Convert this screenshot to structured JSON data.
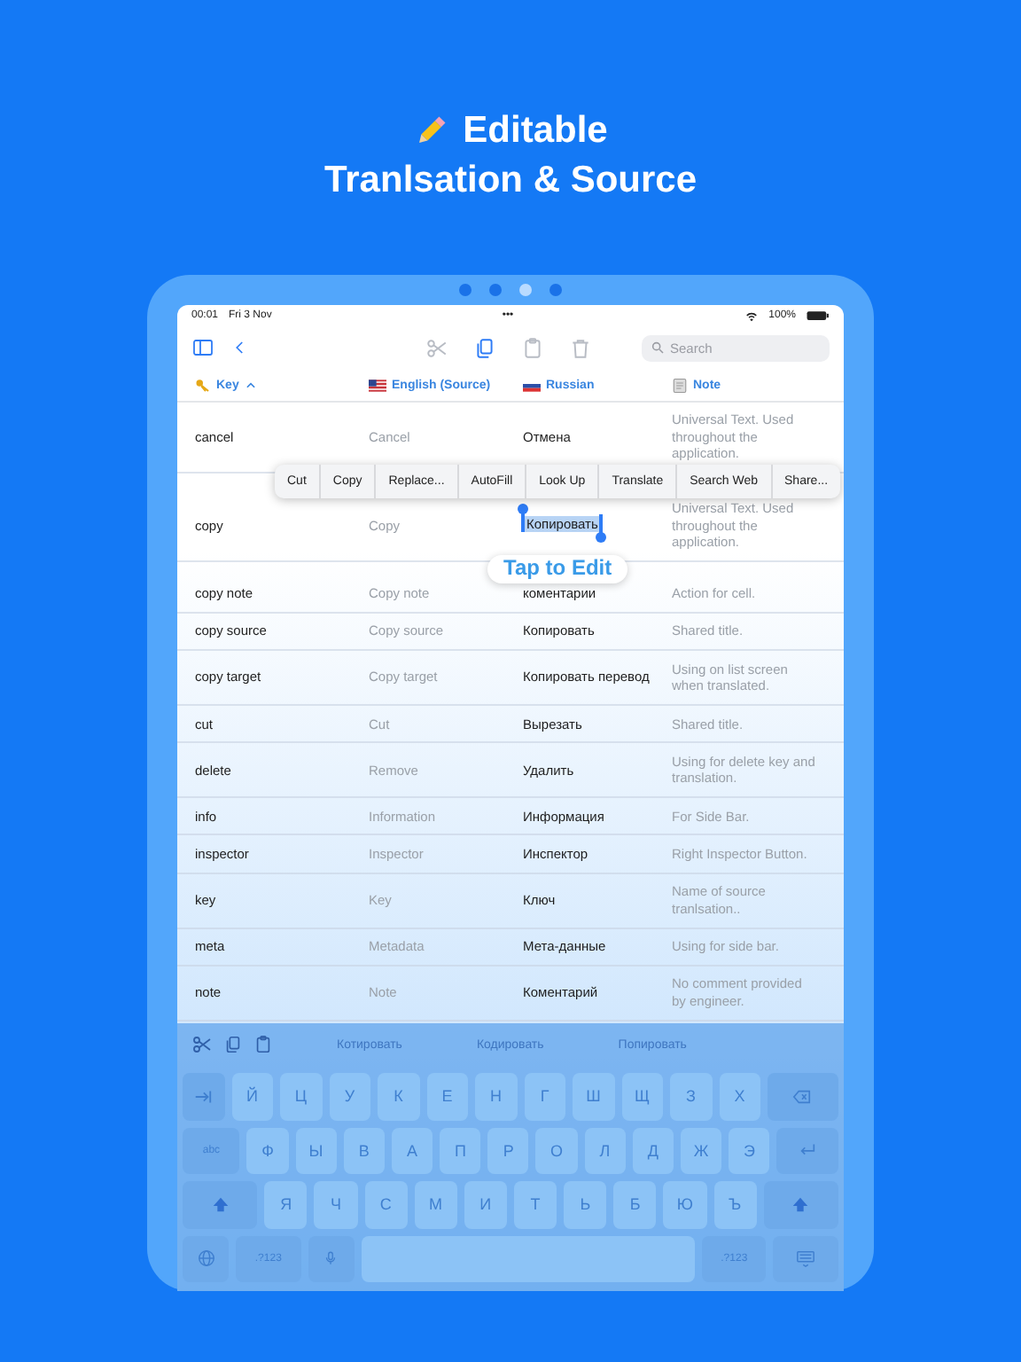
{
  "headline": {
    "title": "Editable",
    "subtitle": "Tranlsation & Source"
  },
  "page_dots": [
    {
      "selected": false
    },
    {
      "selected": false
    },
    {
      "selected": true
    },
    {
      "selected": false
    }
  ],
  "status_bar": {
    "time": "00:01",
    "date": "Fri 3 Nov",
    "dots": "•••",
    "battery": "100%"
  },
  "toolbar": {
    "tools": [
      {
        "kind": "scissors",
        "enabled": false
      },
      {
        "kind": "copy",
        "enabled": true
      },
      {
        "kind": "paste",
        "enabled": false
      },
      {
        "kind": "trash",
        "enabled": false
      }
    ],
    "search": {
      "placeholder": "Search"
    }
  },
  "columns": [
    {
      "kind": "key",
      "label": "Key",
      "sorted": true
    },
    {
      "kind": "us",
      "label": "English (Source)",
      "sorted": false
    },
    {
      "kind": "ru",
      "label": "Russian",
      "sorted": false
    },
    {
      "kind": "note",
      "label": "Note",
      "sorted": false
    }
  ],
  "rows": [
    {
      "key": "cancel",
      "source": "Cancel",
      "translation": "Отмена",
      "note": "Universal Text. Used throughout the application.",
      "text_selected": false
    },
    {
      "key": "copy",
      "source": "Copy",
      "translation": "Копировать",
      "note": "Universal Text. Used throughout the application.",
      "text_selected": true
    },
    {
      "key": "copy note",
      "source": "Copy note",
      "translation": "коментарии",
      "note": "Action for cell.",
      "text_selected": false
    },
    {
      "key": "copy source",
      "source": "Copy source",
      "translation": "Копировать",
      "note": "Shared title.",
      "text_selected": false
    },
    {
      "key": "copy target",
      "source": "Copy target",
      "translation": "Копировать перевод",
      "note": "Using on list screen when translated.",
      "text_selected": false
    },
    {
      "key": "cut",
      "source": "Cut",
      "translation": "Вырезать",
      "note": "Shared title.",
      "text_selected": false
    },
    {
      "key": "delete",
      "source": "Remove",
      "translation": "Удалить",
      "note": "Using for delete key and translation.",
      "text_selected": false
    },
    {
      "key": "info",
      "source": "Information",
      "translation": "Информация",
      "note": "For Side Bar.",
      "text_selected": false
    },
    {
      "key": "inspector",
      "source": "Inspector",
      "translation": "Инспектор",
      "note": "Right Inspector Button.",
      "text_selected": false
    },
    {
      "key": "key",
      "source": "Key",
      "translation": "Ключ",
      "note": "Name of source tranlsation..",
      "text_selected": false
    },
    {
      "key": "meta",
      "source": "Metadata",
      "translation": "Мета-данные",
      "note": "Using for side bar.",
      "text_selected": false
    },
    {
      "key": "note",
      "source": "Note",
      "translation": "Коментарий",
      "note": "No comment provided by engineer.",
      "text_selected": false
    }
  ],
  "context_menu": {
    "items": [
      "Cut",
      "Copy",
      "Replace...",
      "AutoFill",
      "Look Up",
      "Translate",
      "Search Web",
      "Share..."
    ]
  },
  "tap_hint": "Tap to Edit",
  "keyboard": {
    "suggestions": [
      "Котировать",
      "Кодировать",
      "Попировать"
    ],
    "rows": [
      [
        {
          "kind": "tab"
        },
        {
          "kind": "char",
          "label": "Й"
        },
        {
          "kind": "char",
          "label": "Ц"
        },
        {
          "kind": "char",
          "label": "У"
        },
        {
          "kind": "char",
          "label": "К"
        },
        {
          "kind": "char",
          "label": "Е"
        },
        {
          "kind": "char",
          "label": "Н"
        },
        {
          "kind": "char",
          "label": "Г"
        },
        {
          "kind": "char",
          "label": "Ш"
        },
        {
          "kind": "char",
          "label": "Щ"
        },
        {
          "kind": "char",
          "label": "З"
        },
        {
          "kind": "char",
          "label": "Х"
        },
        {
          "kind": "delete"
        }
      ],
      [
        {
          "kind": "text",
          "label": "abc"
        },
        {
          "kind": "char",
          "label": "Ф"
        },
        {
          "kind": "char",
          "label": "Ы"
        },
        {
          "kind": "char",
          "label": "В"
        },
        {
          "kind": "char",
          "label": "А"
        },
        {
          "kind": "char",
          "label": "П"
        },
        {
          "kind": "char",
          "label": "Р"
        },
        {
          "kind": "char",
          "label": "О"
        },
        {
          "kind": "char",
          "label": "Л"
        },
        {
          "kind": "char",
          "label": "Д"
        },
        {
          "kind": "char",
          "label": "Ж"
        },
        {
          "kind": "char",
          "label": "Э"
        },
        {
          "kind": "return"
        }
      ],
      [
        {
          "kind": "shift"
        },
        {
          "kind": "char",
          "label": "Я"
        },
        {
          "kind": "char",
          "label": "Ч"
        },
        {
          "kind": "char",
          "label": "С"
        },
        {
          "kind": "char",
          "label": "М"
        },
        {
          "kind": "char",
          "label": "И"
        },
        {
          "kind": "char",
          "label": "Т"
        },
        {
          "kind": "char",
          "label": "Ь"
        },
        {
          "kind": "char",
          "label": "Б"
        },
        {
          "kind": "char",
          "label": "Ю"
        },
        {
          "kind": "char",
          "label": "Ъ"
        },
        {
          "kind": "shift"
        }
      ],
      [
        {
          "kind": "globe"
        },
        {
          "kind": "text",
          "label": ".?123"
        },
        {
          "kind": "mic"
        },
        {
          "kind": "space"
        },
        {
          "kind": "text",
          "label": ".?123"
        },
        {
          "kind": "hide"
        }
      ]
    ]
  }
}
